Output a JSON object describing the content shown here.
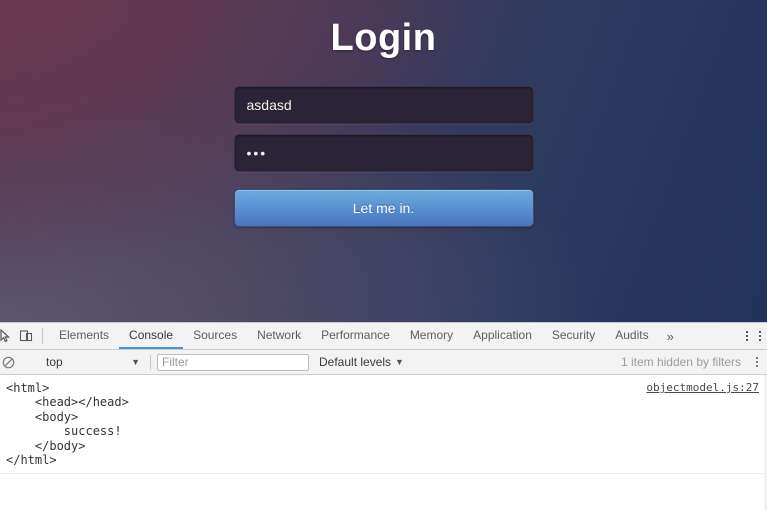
{
  "page": {
    "title": "Login",
    "username_field": {
      "value": "asdasd",
      "placeholder": ""
    },
    "password_field": {
      "value": "•••",
      "placeholder": ""
    },
    "submit_label": "Let me in.",
    "colors": {
      "bg_purple": "#4e2f44",
      "bg_navy": "#21335b",
      "field_bg": "#2b2436",
      "button_top": "#6fabde",
      "button_bottom": "#4b74bf",
      "title_color": "#ffffff"
    }
  },
  "devtools": {
    "tabs": [
      {
        "label": "Elements",
        "active": false
      },
      {
        "label": "Console",
        "active": true
      },
      {
        "label": "Sources",
        "active": false
      },
      {
        "label": "Network",
        "active": false
      },
      {
        "label": "Performance",
        "active": false
      },
      {
        "label": "Memory",
        "active": false
      },
      {
        "label": "Application",
        "active": false
      },
      {
        "label": "Security",
        "active": false
      },
      {
        "label": "Audits",
        "active": false
      }
    ],
    "overflow_label": "»",
    "icons": {
      "inspect": "inspect-element-icon",
      "device": "device-toolbar-icon",
      "clear": "clear-console-icon",
      "more": "more-options-icon"
    },
    "filter_bar": {
      "context_value": "top",
      "context_caret": "▼",
      "filter_placeholder": "Filter",
      "filter_value": "",
      "levels_label": "Default levels",
      "levels_caret": "▼",
      "hidden_items_note": "1 item hidden by filters"
    },
    "console": {
      "message": "<html>\n    <head></head>\n    <body>\n        success!\n    </body>\n</html>",
      "source_link": "objectmodel.js:27"
    },
    "active_tab_underline_color": "#4a90d9"
  }
}
